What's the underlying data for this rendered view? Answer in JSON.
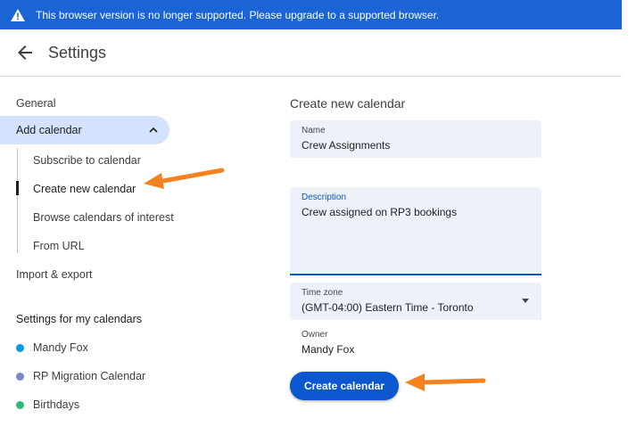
{
  "banner": {
    "text": "This browser version is no longer supported. Please upgrade to a supported browser.",
    "icon": "warning-icon"
  },
  "header": {
    "title": "Settings",
    "back_icon": "arrow-back-icon"
  },
  "sidebar": {
    "general": "General",
    "add_calendar": "Add calendar",
    "add_calendar_subitems": [
      "Subscribe to calendar",
      "Create new calendar",
      "Browse calendars of interest",
      "From URL"
    ],
    "active_subitem": "Create new calendar",
    "import_export": "Import & export",
    "my_calendars_heading": "Settings for my calendars",
    "calendars": [
      {
        "name": "Mandy Fox",
        "color": "#039be5"
      },
      {
        "name": "RP Migration Calendar",
        "color": "#7986cb"
      },
      {
        "name": "Birthdays",
        "color": "#33b679"
      }
    ]
  },
  "form": {
    "title": "Create new calendar",
    "name_label": "Name",
    "name_value": "Crew Assignments",
    "description_label": "Description",
    "description_value": "Crew assigned on RP3 bookings",
    "timezone_label": "Time zone",
    "timezone_value": "(GMT-04:00) Eastern Time - Toronto",
    "owner_label": "Owner",
    "owner_value": "Mandy Fox",
    "create_button": "Create calendar"
  },
  "colors": {
    "banner": "#1a64d6",
    "accent": "#0b57d0",
    "annotation_arrow": "#f5821f",
    "active_nav": "#d3e3fd"
  }
}
